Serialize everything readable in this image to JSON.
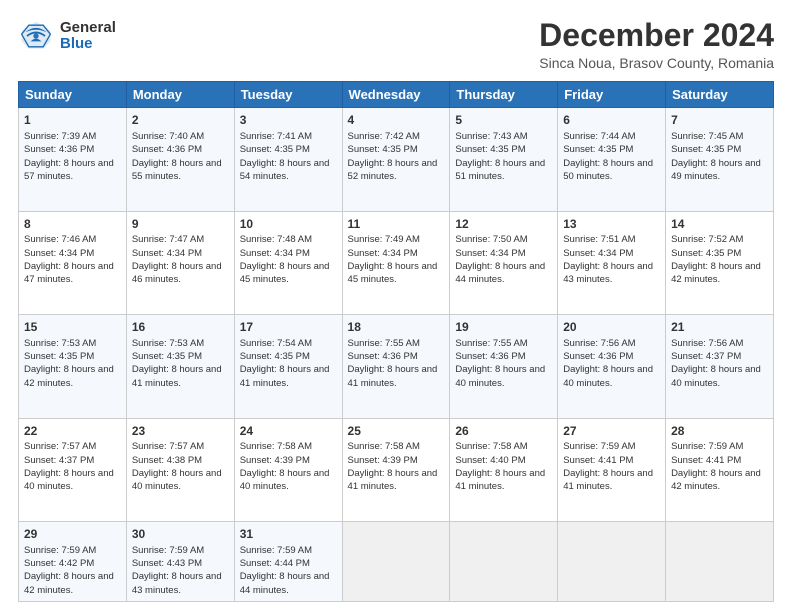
{
  "logo": {
    "general": "General",
    "blue": "Blue"
  },
  "title": "December 2024",
  "subtitle": "Sinca Noua, Brasov County, Romania",
  "days_header": [
    "Sunday",
    "Monday",
    "Tuesday",
    "Wednesday",
    "Thursday",
    "Friday",
    "Saturday"
  ],
  "weeks": [
    [
      {
        "day": "1",
        "sunrise": "Sunrise: 7:39 AM",
        "sunset": "Sunset: 4:36 PM",
        "daylight": "Daylight: 8 hours and 57 minutes."
      },
      {
        "day": "2",
        "sunrise": "Sunrise: 7:40 AM",
        "sunset": "Sunset: 4:36 PM",
        "daylight": "Daylight: 8 hours and 55 minutes."
      },
      {
        "day": "3",
        "sunrise": "Sunrise: 7:41 AM",
        "sunset": "Sunset: 4:35 PM",
        "daylight": "Daylight: 8 hours and 54 minutes."
      },
      {
        "day": "4",
        "sunrise": "Sunrise: 7:42 AM",
        "sunset": "Sunset: 4:35 PM",
        "daylight": "Daylight: 8 hours and 52 minutes."
      },
      {
        "day": "5",
        "sunrise": "Sunrise: 7:43 AM",
        "sunset": "Sunset: 4:35 PM",
        "daylight": "Daylight: 8 hours and 51 minutes."
      },
      {
        "day": "6",
        "sunrise": "Sunrise: 7:44 AM",
        "sunset": "Sunset: 4:35 PM",
        "daylight": "Daylight: 8 hours and 50 minutes."
      },
      {
        "day": "7",
        "sunrise": "Sunrise: 7:45 AM",
        "sunset": "Sunset: 4:35 PM",
        "daylight": "Daylight: 8 hours and 49 minutes."
      }
    ],
    [
      {
        "day": "8",
        "sunrise": "Sunrise: 7:46 AM",
        "sunset": "Sunset: 4:34 PM",
        "daylight": "Daylight: 8 hours and 47 minutes."
      },
      {
        "day": "9",
        "sunrise": "Sunrise: 7:47 AM",
        "sunset": "Sunset: 4:34 PM",
        "daylight": "Daylight: 8 hours and 46 minutes."
      },
      {
        "day": "10",
        "sunrise": "Sunrise: 7:48 AM",
        "sunset": "Sunset: 4:34 PM",
        "daylight": "Daylight: 8 hours and 45 minutes."
      },
      {
        "day": "11",
        "sunrise": "Sunrise: 7:49 AM",
        "sunset": "Sunset: 4:34 PM",
        "daylight": "Daylight: 8 hours and 45 minutes."
      },
      {
        "day": "12",
        "sunrise": "Sunrise: 7:50 AM",
        "sunset": "Sunset: 4:34 PM",
        "daylight": "Daylight: 8 hours and 44 minutes."
      },
      {
        "day": "13",
        "sunrise": "Sunrise: 7:51 AM",
        "sunset": "Sunset: 4:34 PM",
        "daylight": "Daylight: 8 hours and 43 minutes."
      },
      {
        "day": "14",
        "sunrise": "Sunrise: 7:52 AM",
        "sunset": "Sunset: 4:35 PM",
        "daylight": "Daylight: 8 hours and 42 minutes."
      }
    ],
    [
      {
        "day": "15",
        "sunrise": "Sunrise: 7:53 AM",
        "sunset": "Sunset: 4:35 PM",
        "daylight": "Daylight: 8 hours and 42 minutes."
      },
      {
        "day": "16",
        "sunrise": "Sunrise: 7:53 AM",
        "sunset": "Sunset: 4:35 PM",
        "daylight": "Daylight: 8 hours and 41 minutes."
      },
      {
        "day": "17",
        "sunrise": "Sunrise: 7:54 AM",
        "sunset": "Sunset: 4:35 PM",
        "daylight": "Daylight: 8 hours and 41 minutes."
      },
      {
        "day": "18",
        "sunrise": "Sunrise: 7:55 AM",
        "sunset": "Sunset: 4:36 PM",
        "daylight": "Daylight: 8 hours and 41 minutes."
      },
      {
        "day": "19",
        "sunrise": "Sunrise: 7:55 AM",
        "sunset": "Sunset: 4:36 PM",
        "daylight": "Daylight: 8 hours and 40 minutes."
      },
      {
        "day": "20",
        "sunrise": "Sunrise: 7:56 AM",
        "sunset": "Sunset: 4:36 PM",
        "daylight": "Daylight: 8 hours and 40 minutes."
      },
      {
        "day": "21",
        "sunrise": "Sunrise: 7:56 AM",
        "sunset": "Sunset: 4:37 PM",
        "daylight": "Daylight: 8 hours and 40 minutes."
      }
    ],
    [
      {
        "day": "22",
        "sunrise": "Sunrise: 7:57 AM",
        "sunset": "Sunset: 4:37 PM",
        "daylight": "Daylight: 8 hours and 40 minutes."
      },
      {
        "day": "23",
        "sunrise": "Sunrise: 7:57 AM",
        "sunset": "Sunset: 4:38 PM",
        "daylight": "Daylight: 8 hours and 40 minutes."
      },
      {
        "day": "24",
        "sunrise": "Sunrise: 7:58 AM",
        "sunset": "Sunset: 4:39 PM",
        "daylight": "Daylight: 8 hours and 40 minutes."
      },
      {
        "day": "25",
        "sunrise": "Sunrise: 7:58 AM",
        "sunset": "Sunset: 4:39 PM",
        "daylight": "Daylight: 8 hours and 41 minutes."
      },
      {
        "day": "26",
        "sunrise": "Sunrise: 7:58 AM",
        "sunset": "Sunset: 4:40 PM",
        "daylight": "Daylight: 8 hours and 41 minutes."
      },
      {
        "day": "27",
        "sunrise": "Sunrise: 7:59 AM",
        "sunset": "Sunset: 4:41 PM",
        "daylight": "Daylight: 8 hours and 41 minutes."
      },
      {
        "day": "28",
        "sunrise": "Sunrise: 7:59 AM",
        "sunset": "Sunset: 4:41 PM",
        "daylight": "Daylight: 8 hours and 42 minutes."
      }
    ],
    [
      {
        "day": "29",
        "sunrise": "Sunrise: 7:59 AM",
        "sunset": "Sunset: 4:42 PM",
        "daylight": "Daylight: 8 hours and 42 minutes."
      },
      {
        "day": "30",
        "sunrise": "Sunrise: 7:59 AM",
        "sunset": "Sunset: 4:43 PM",
        "daylight": "Daylight: 8 hours and 43 minutes."
      },
      {
        "day": "31",
        "sunrise": "Sunrise: 7:59 AM",
        "sunset": "Sunset: 4:44 PM",
        "daylight": "Daylight: 8 hours and 44 minutes."
      },
      null,
      null,
      null,
      null
    ]
  ]
}
